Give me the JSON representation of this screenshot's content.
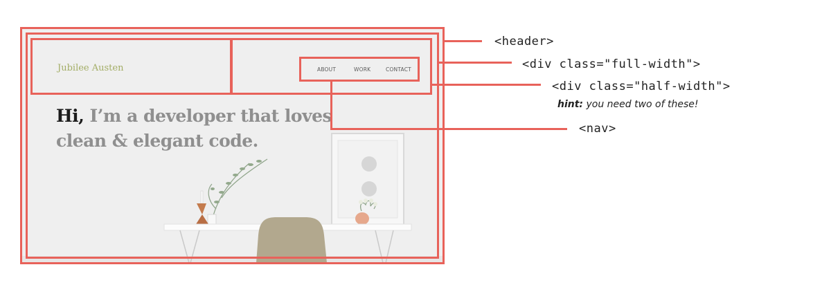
{
  "mockup": {
    "brand": "Jubilee Austen",
    "nav": {
      "about": "ABOUT",
      "work": "WORK",
      "contact": "CONTACT"
    },
    "hero": {
      "greeting": "Hi,",
      "line1_rest": " I’m a developer that loves",
      "line2": "clean & elegant code."
    }
  },
  "annotations": {
    "header": "<header>",
    "full_width": "<div class=\"full-width\">",
    "half_width": "<div class=\"half-width\">",
    "hint_bold": "hint:",
    "hint_text": " you need two of these!",
    "nav": "<nav>"
  },
  "colors": {
    "outline": "#e8625a",
    "brand": "#a3ad66",
    "hero_text": "#8f8f8f",
    "hero_lead": "#1c1c1c",
    "background": "#efefef"
  }
}
